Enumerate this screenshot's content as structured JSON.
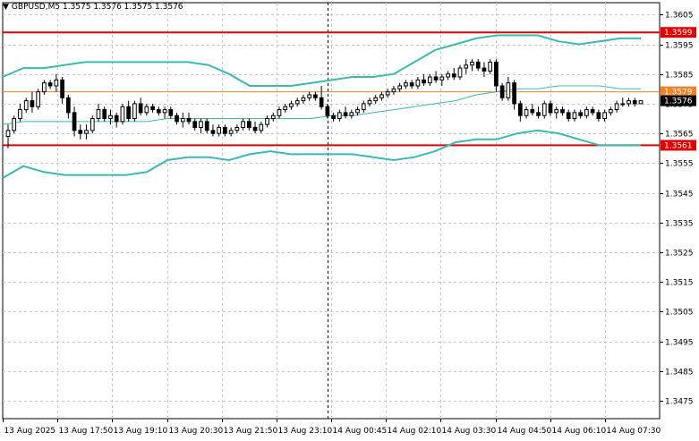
{
  "chart_data": {
    "type": "candlestick",
    "symbol": "GBPUSD,M5",
    "ohlc_text": "1.3575 1.3576 1.3575 1.3576",
    "header_icon": "triangle-down-icon",
    "ylim": [
      1.3469,
      1.3609
    ],
    "y_ticks": [
      "1.3605",
      "1.3595",
      "1.3585",
      "1.3575",
      "1.3565",
      "1.3555",
      "1.3545",
      "1.3535",
      "1.3525",
      "1.3515",
      "1.3505",
      "1.3495",
      "1.3485",
      "1.3475"
    ],
    "y_tick_values": [
      1.3605,
      1.3595,
      1.3585,
      1.3575,
      1.3565,
      1.3555,
      1.3545,
      1.3535,
      1.3525,
      1.3515,
      1.3505,
      1.3495,
      1.3485,
      1.3475
    ],
    "x_ticks": [
      "13 Aug 2025",
      "13 Aug 17:50",
      "13 Aug 19:10",
      "13 Aug 20:30",
      "13 Aug 21:50",
      "13 Aug 23:10",
      "14 Aug 00:45",
      "14 Aug 02:10",
      "14 Aug 03:30",
      "14 Aug 04:50",
      "14 Aug 06:10",
      "14 Aug 07:30"
    ],
    "grid": true,
    "levels": [
      {
        "label": "1.3599",
        "value": 1.3599,
        "color": "#e00000"
      },
      {
        "label": "1.3579",
        "value": 1.3579,
        "color": "#f0832a"
      },
      {
        "label": "1.3561",
        "value": 1.3561,
        "color": "#e00000"
      }
    ],
    "current_price": {
      "label": "1.3576",
      "value": 1.3576
    },
    "bands_color": "#3cb9b0",
    "separator_index": 53,
    "bollinger": {
      "upper": [
        1.3584,
        1.3587,
        1.3587,
        1.3588,
        1.3589,
        1.3589,
        1.3589,
        1.3589,
        1.3589,
        1.3589,
        1.3588,
        1.3585,
        1.3581,
        1.3581,
        1.3581,
        1.3582,
        1.3583,
        1.3584,
        1.3584,
        1.3585,
        1.3589,
        1.3593,
        1.3595,
        1.3597,
        1.3598,
        1.3598,
        1.3598,
        1.3596,
        1.3595,
        1.3596,
        1.3597,
        1.3597
      ],
      "middle": [
        1.3568,
        1.3569,
        1.3569,
        1.3569,
        1.3569,
        1.3569,
        1.3569,
        1.3569,
        1.357,
        1.357,
        1.357,
        1.357,
        1.357,
        1.357,
        1.357,
        1.357,
        1.3571,
        1.3571,
        1.3572,
        1.3573,
        1.3574,
        1.3575,
        1.3576,
        1.3578,
        1.3579,
        1.358,
        1.358,
        1.3581,
        1.3581,
        1.3581,
        1.358,
        1.358
      ],
      "lower": [
        1.355,
        1.3554,
        1.3552,
        1.3551,
        1.3551,
        1.3551,
        1.3551,
        1.3552,
        1.3556,
        1.3557,
        1.3557,
        1.3556,
        1.3558,
        1.3559,
        1.3558,
        1.3558,
        1.3558,
        1.3558,
        1.3557,
        1.3556,
        1.3557,
        1.3559,
        1.3562,
        1.3563,
        1.3563,
        1.3565,
        1.3566,
        1.3565,
        1.3563,
        1.3561,
        1.3561,
        1.3561
      ]
    },
    "candles": [
      [
        1.3564,
        1.3568,
        1.356,
        1.3566
      ],
      [
        1.3566,
        1.3571,
        1.3565,
        1.357
      ],
      [
        1.357,
        1.3575,
        1.3569,
        1.3573
      ],
      [
        1.3573,
        1.3577,
        1.3572,
        1.3576
      ],
      [
        1.3576,
        1.3579,
        1.3572,
        1.3574
      ],
      [
        1.3574,
        1.358,
        1.3573,
        1.3579
      ],
      [
        1.3579,
        1.3583,
        1.3578,
        1.3582
      ],
      [
        1.3582,
        1.3583,
        1.358,
        1.3581
      ],
      [
        1.3581,
        1.3585,
        1.3579,
        1.3583
      ],
      [
        1.3583,
        1.3584,
        1.3575,
        1.3577
      ],
      [
        1.3577,
        1.3578,
        1.357,
        1.3572
      ],
      [
        1.3572,
        1.3574,
        1.3564,
        1.3566
      ],
      [
        1.3566,
        1.3568,
        1.3563,
        1.3565
      ],
      [
        1.3565,
        1.3568,
        1.3563,
        1.3566
      ],
      [
        1.3566,
        1.3571,
        1.3565,
        1.357
      ],
      [
        1.357,
        1.3575,
        1.3569,
        1.3573
      ],
      [
        1.3573,
        1.3574,
        1.3569,
        1.357
      ],
      [
        1.357,
        1.3573,
        1.3568,
        1.3571
      ],
      [
        1.3571,
        1.3572,
        1.3567,
        1.3569
      ],
      [
        1.3569,
        1.3575,
        1.3568,
        1.3574
      ],
      [
        1.3574,
        1.3576,
        1.3569,
        1.357
      ],
      [
        1.357,
        1.3576,
        1.3569,
        1.3575
      ],
      [
        1.3575,
        1.3577,
        1.3571,
        1.3572
      ],
      [
        1.3572,
        1.3575,
        1.3571,
        1.3574
      ],
      [
        1.3574,
        1.3575,
        1.3572,
        1.3573
      ],
      [
        1.3573,
        1.3574,
        1.3571,
        1.3572
      ],
      [
        1.3572,
        1.3574,
        1.357,
        1.3573
      ],
      [
        1.3573,
        1.3574,
        1.357,
        1.3571
      ],
      [
        1.3571,
        1.3572,
        1.3568,
        1.3569
      ],
      [
        1.3569,
        1.3572,
        1.3567,
        1.357
      ],
      [
        1.357,
        1.3572,
        1.3568,
        1.3569
      ],
      [
        1.3569,
        1.357,
        1.3566,
        1.3567
      ],
      [
        1.3567,
        1.357,
        1.3565,
        1.3569
      ],
      [
        1.3569,
        1.357,
        1.3565,
        1.3566
      ],
      [
        1.3566,
        1.3568,
        1.3564,
        1.3565
      ],
      [
        1.3565,
        1.3568,
        1.3564,
        1.3567
      ],
      [
        1.3567,
        1.3568,
        1.3564,
        1.3565
      ],
      [
        1.3565,
        1.3567,
        1.3564,
        1.3566
      ],
      [
        1.3566,
        1.3568,
        1.3565,
        1.3567
      ],
      [
        1.3567,
        1.357,
        1.3566,
        1.3569
      ],
      [
        1.3569,
        1.357,
        1.3566,
        1.3567
      ],
      [
        1.3567,
        1.3569,
        1.3565,
        1.3566
      ],
      [
        1.3566,
        1.3569,
        1.3565,
        1.3568
      ],
      [
        1.3568,
        1.3571,
        1.3567,
        1.357
      ],
      [
        1.357,
        1.3572,
        1.3569,
        1.3571
      ],
      [
        1.3571,
        1.3574,
        1.357,
        1.3573
      ],
      [
        1.3573,
        1.3575,
        1.3572,
        1.3574
      ],
      [
        1.3574,
        1.3576,
        1.3573,
        1.3575
      ],
      [
        1.3575,
        1.3577,
        1.3574,
        1.3576
      ],
      [
        1.3576,
        1.3578,
        1.3575,
        1.3577
      ],
      [
        1.3577,
        1.3579,
        1.3576,
        1.3578
      ],
      [
        1.3578,
        1.3579,
        1.3576,
        1.3577
      ],
      [
        1.3577,
        1.3581,
        1.3573,
        1.3574
      ],
      [
        1.3574,
        1.3575,
        1.357,
        1.3571
      ],
      [
        1.3571,
        1.3572,
        1.3569,
        1.357
      ],
      [
        1.357,
        1.3573,
        1.3569,
        1.3572
      ],
      [
        1.3572,
        1.3574,
        1.357,
        1.3571
      ],
      [
        1.3571,
        1.3573,
        1.357,
        1.3572
      ],
      [
        1.3572,
        1.3574,
        1.3571,
        1.3573
      ],
      [
        1.3573,
        1.3576,
        1.3572,
        1.3575
      ],
      [
        1.3575,
        1.3577,
        1.3574,
        1.3576
      ],
      [
        1.3576,
        1.3578,
        1.3575,
        1.3577
      ],
      [
        1.3577,
        1.3579,
        1.3576,
        1.3578
      ],
      [
        1.3578,
        1.358,
        1.3577,
        1.3579
      ],
      [
        1.3579,
        1.3581,
        1.3578,
        1.358
      ],
      [
        1.358,
        1.3582,
        1.3579,
        1.3581
      ],
      [
        1.3581,
        1.3583,
        1.358,
        1.3582
      ],
      [
        1.3582,
        1.3583,
        1.358,
        1.3581
      ],
      [
        1.3581,
        1.3584,
        1.358,
        1.3583
      ],
      [
        1.3583,
        1.3585,
        1.3581,
        1.3582
      ],
      [
        1.3582,
        1.3585,
        1.3581,
        1.3584
      ],
      [
        1.3584,
        1.3586,
        1.3582,
        1.3583
      ],
      [
        1.3583,
        1.3585,
        1.3581,
        1.3584
      ],
      [
        1.3584,
        1.3586,
        1.3583,
        1.3585
      ],
      [
        1.3585,
        1.3587,
        1.3583,
        1.3584
      ],
      [
        1.3584,
        1.3588,
        1.3583,
        1.3587
      ],
      [
        1.3587,
        1.359,
        1.3585,
        1.3588
      ],
      [
        1.3588,
        1.359,
        1.3586,
        1.3589
      ],
      [
        1.3589,
        1.359,
        1.3586,
        1.3587
      ],
      [
        1.3587,
        1.3589,
        1.3584,
        1.3586
      ],
      [
        1.3586,
        1.359,
        1.3585,
        1.3589
      ],
      [
        1.3589,
        1.359,
        1.3579,
        1.3581
      ],
      [
        1.3581,
        1.3582,
        1.3576,
        1.3577
      ],
      [
        1.3577,
        1.3584,
        1.3576,
        1.3582
      ],
      [
        1.3582,
        1.3583,
        1.3573,
        1.3575
      ],
      [
        1.3575,
        1.3576,
        1.3569,
        1.3571
      ],
      [
        1.3571,
        1.3574,
        1.357,
        1.3573
      ],
      [
        1.3573,
        1.3575,
        1.3571,
        1.3572
      ],
      [
        1.3572,
        1.3574,
        1.357,
        1.3571
      ],
      [
        1.3571,
        1.3576,
        1.357,
        1.3575
      ],
      [
        1.3575,
        1.3576,
        1.3571,
        1.3572
      ],
      [
        1.3572,
        1.3574,
        1.357,
        1.3573
      ],
      [
        1.3573,
        1.3574,
        1.3571,
        1.3572
      ],
      [
        1.3572,
        1.3573,
        1.3569,
        1.357
      ],
      [
        1.357,
        1.3573,
        1.3569,
        1.3572
      ],
      [
        1.3572,
        1.3573,
        1.357,
        1.3571
      ],
      [
        1.3571,
        1.3574,
        1.357,
        1.3573
      ],
      [
        1.3573,
        1.3574,
        1.3571,
        1.3572
      ],
      [
        1.3572,
        1.3573,
        1.3569,
        1.357
      ],
      [
        1.357,
        1.3573,
        1.3569,
        1.3572
      ],
      [
        1.3572,
        1.3574,
        1.3571,
        1.3573
      ],
      [
        1.3573,
        1.3576,
        1.3572,
        1.3575
      ],
      [
        1.3575,
        1.3577,
        1.3574,
        1.3575
      ],
      [
        1.3575,
        1.3577,
        1.3574,
        1.3576
      ],
      [
        1.3576,
        1.3577,
        1.3574,
        1.3575
      ],
      [
        1.3575,
        1.3576,
        1.3575,
        1.3576
      ]
    ]
  }
}
